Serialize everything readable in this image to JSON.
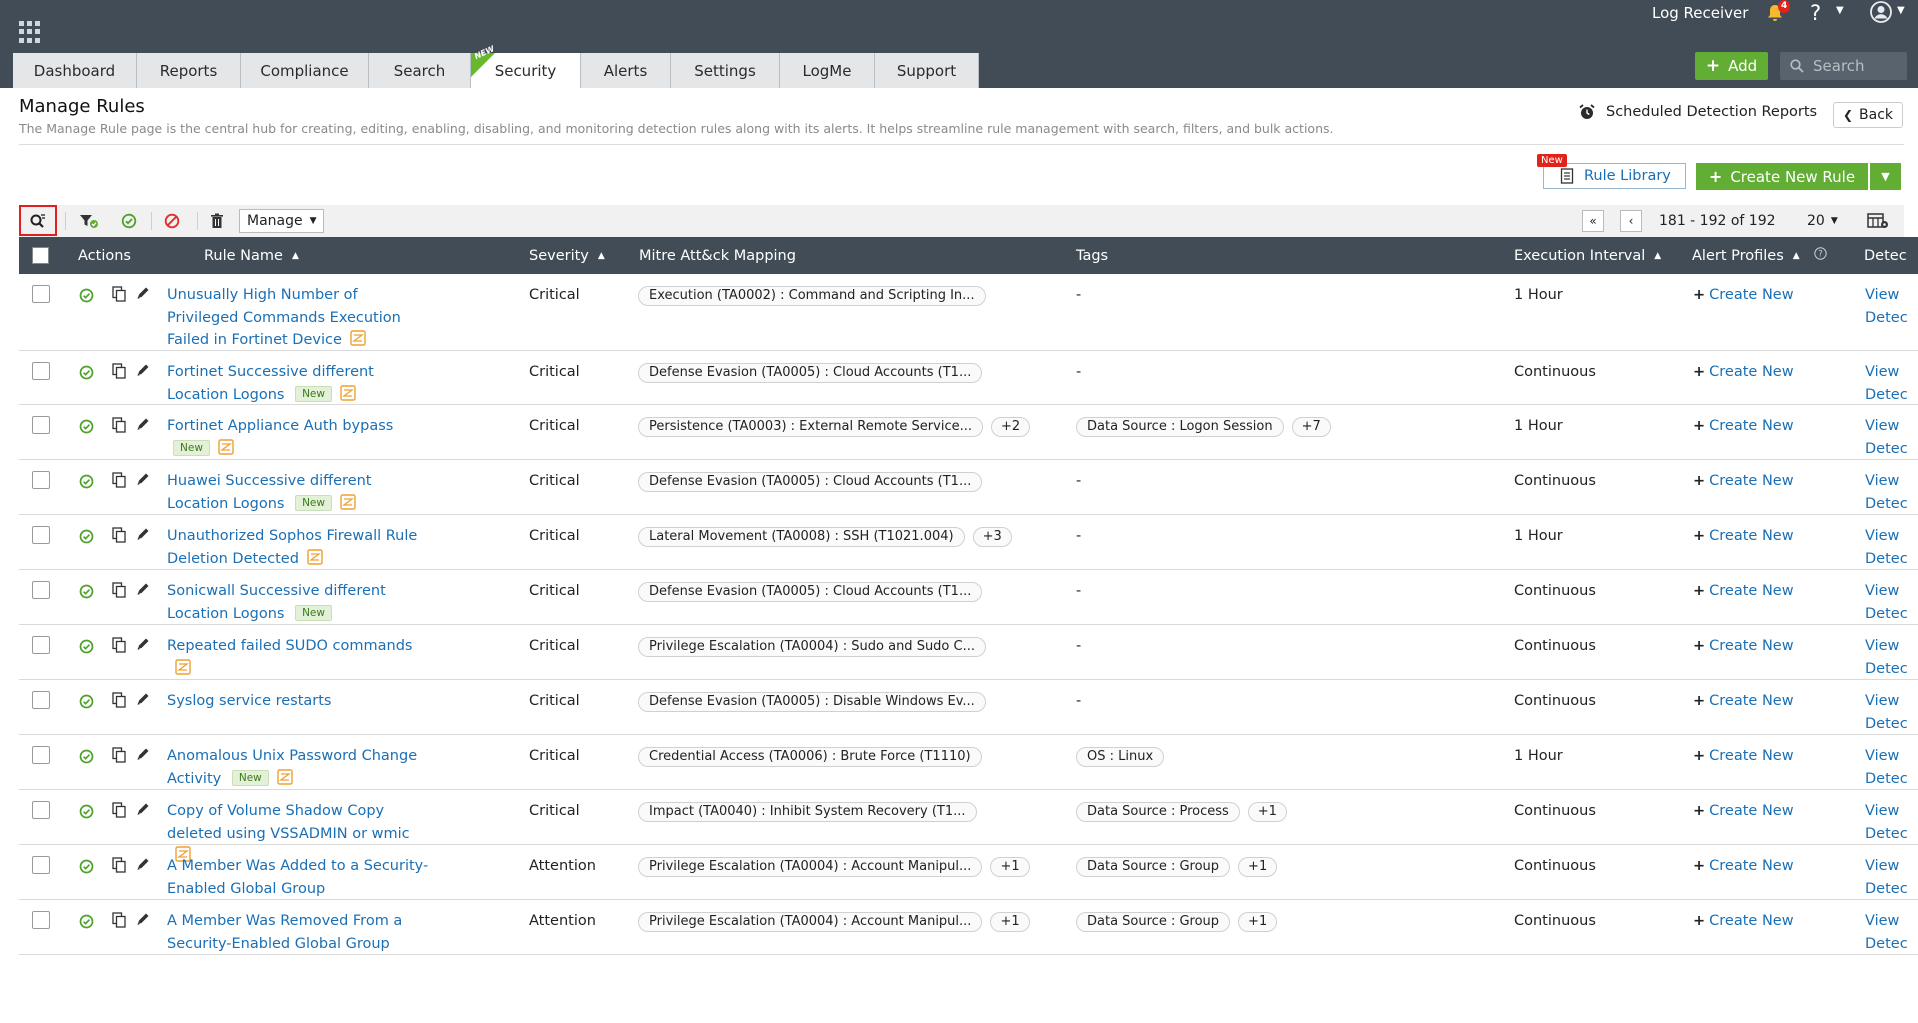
{
  "header": {
    "product_name": "Log Receiver",
    "notification_count": "4",
    "help_symbol": "?",
    "add_label": "Add",
    "search_placeholder": "Search",
    "tabs": [
      {
        "label": "Dashboard",
        "active": false
      },
      {
        "label": "Reports",
        "active": false
      },
      {
        "label": "Compliance",
        "active": false
      },
      {
        "label": "Search",
        "active": false
      },
      {
        "label": "Security",
        "active": true,
        "badge": "NEW"
      },
      {
        "label": "Alerts",
        "active": false
      },
      {
        "label": "Settings",
        "active": false
      },
      {
        "label": "LogMe",
        "active": false
      },
      {
        "label": "Support",
        "active": false
      }
    ]
  },
  "page": {
    "title": "Manage Rules",
    "description": "The Manage Rule page is the central hub for creating, editing, enabling, disabling, and monitoring detection rules along with its alerts. It helps streamline rule management with search, filters, and bulk actions.",
    "scheduled_reports_label": "Scheduled Detection Reports",
    "back_label": "Back",
    "rule_library_label": "Rule Library",
    "rule_library_badge": "New",
    "create_rule_label": "Create New Rule"
  },
  "toolbar": {
    "manage_label": "Manage",
    "pagination_text": "181 - 192 of 192",
    "page_size": "20"
  },
  "table": {
    "columns": {
      "actions": "Actions",
      "rule_name": "Rule Name",
      "severity": "Severity",
      "mitre": "Mitre Att&ck Mapping",
      "tags": "Tags",
      "interval": "Execution Interval",
      "alert_profiles": "Alert Profiles",
      "detections": "Detec"
    },
    "new_tag_label": "New",
    "create_new_label": "Create New",
    "view_label": "View",
    "detections_label": "Detec",
    "rows": [
      {
        "name": "Unusually High Number of Privileged Commands Execution Failed in Fortinet Device",
        "severity": "Critical",
        "mitre": "Execution (TA0002) : Command and Scripting In...",
        "mitre_more": "",
        "tags": "-",
        "tags_pill": false,
        "tags_more": "",
        "interval": "1 Hour",
        "is_new": false,
        "correlation": true
      },
      {
        "name": "Fortinet Successive different Location Logons",
        "severity": "Critical",
        "mitre": "Defense Evasion (TA0005) : Cloud Accounts (T1...",
        "mitre_more": "",
        "tags": "-",
        "tags_pill": false,
        "tags_more": "",
        "interval": "Continuous",
        "is_new": true,
        "correlation": true
      },
      {
        "name": "Fortinet Appliance Auth bypass",
        "severity": "Critical",
        "mitre": "Persistence (TA0003) : External Remote Service...",
        "mitre_more": "+2",
        "tags": "Data Source : Logon Session",
        "tags_pill": true,
        "tags_more": "+7",
        "interval": "1 Hour",
        "is_new": true,
        "correlation": true
      },
      {
        "name": "Huawei Successive different Location Logons",
        "severity": "Critical",
        "mitre": "Defense Evasion (TA0005) : Cloud Accounts (T1...",
        "mitre_more": "",
        "tags": "-",
        "tags_pill": false,
        "tags_more": "",
        "interval": "Continuous",
        "is_new": true,
        "correlation": true
      },
      {
        "name": "Unauthorized Sophos Firewall Rule Deletion Detected",
        "severity": "Critical",
        "mitre": "Lateral Movement (TA0008) : SSH (T1021.004)",
        "mitre_more": "+3",
        "tags": "-",
        "tags_pill": false,
        "tags_more": "",
        "interval": "1 Hour",
        "is_new": false,
        "correlation": true
      },
      {
        "name": "Sonicwall Successive different Location Logons",
        "severity": "Critical",
        "mitre": "Defense Evasion (TA0005) : Cloud Accounts (T1...",
        "mitre_more": "",
        "tags": "-",
        "tags_pill": false,
        "tags_more": "",
        "interval": "Continuous",
        "is_new": true,
        "correlation": false
      },
      {
        "name": "Repeated failed SUDO commands",
        "severity": "Critical",
        "mitre": "Privilege Escalation (TA0004) : Sudo and Sudo C...",
        "mitre_more": "",
        "tags": "-",
        "tags_pill": false,
        "tags_more": "",
        "interval": "Continuous",
        "is_new": false,
        "correlation": true
      },
      {
        "name": "Syslog service restarts",
        "severity": "Critical",
        "mitre": "Defense Evasion (TA0005) : Disable Windows Ev...",
        "mitre_more": "",
        "tags": "-",
        "tags_pill": false,
        "tags_more": "",
        "interval": "Continuous",
        "is_new": false,
        "correlation": false
      },
      {
        "name": "Anomalous Unix Password Change Activity",
        "severity": "Critical",
        "mitre": "Credential Access (TA0006) : Brute Force (T1110)",
        "mitre_more": "",
        "tags": "OS : Linux",
        "tags_pill": true,
        "tags_more": "",
        "interval": "1 Hour",
        "is_new": true,
        "correlation": true
      },
      {
        "name": "Copy of Volume Shadow Copy deleted using VSSADMIN or wmic",
        "severity": "Critical",
        "mitre": "Impact (TA0040) : Inhibit System Recovery (T1...",
        "mitre_more": "",
        "tags": "Data Source : Process",
        "tags_pill": true,
        "tags_more": "+1",
        "interval": "Continuous",
        "is_new": false,
        "correlation": true
      },
      {
        "name": "A Member Was Added to a Security-Enabled Global Group",
        "severity": "Attention",
        "mitre": "Privilege Escalation (TA0004) : Account Manipul...",
        "mitre_more": "+1",
        "tags": "Data Source : Group",
        "tags_pill": true,
        "tags_more": "+1",
        "interval": "Continuous",
        "is_new": false,
        "correlation": false
      },
      {
        "name": "A Member Was Removed From a Security-Enabled Global Group",
        "severity": "Attention",
        "mitre": "Privilege Escalation (TA0004) : Account Manipul...",
        "mitre_more": "+1",
        "tags": "Data Source : Group",
        "tags_pill": true,
        "tags_more": "+1",
        "interval": "Continuous",
        "is_new": false,
        "correlation": false
      }
    ]
  },
  "colors": {
    "topbar": "#414c56",
    "accent_green": "#62ae34",
    "link_blue": "#1a6fb5",
    "correlation_orange": "#f0a030"
  }
}
